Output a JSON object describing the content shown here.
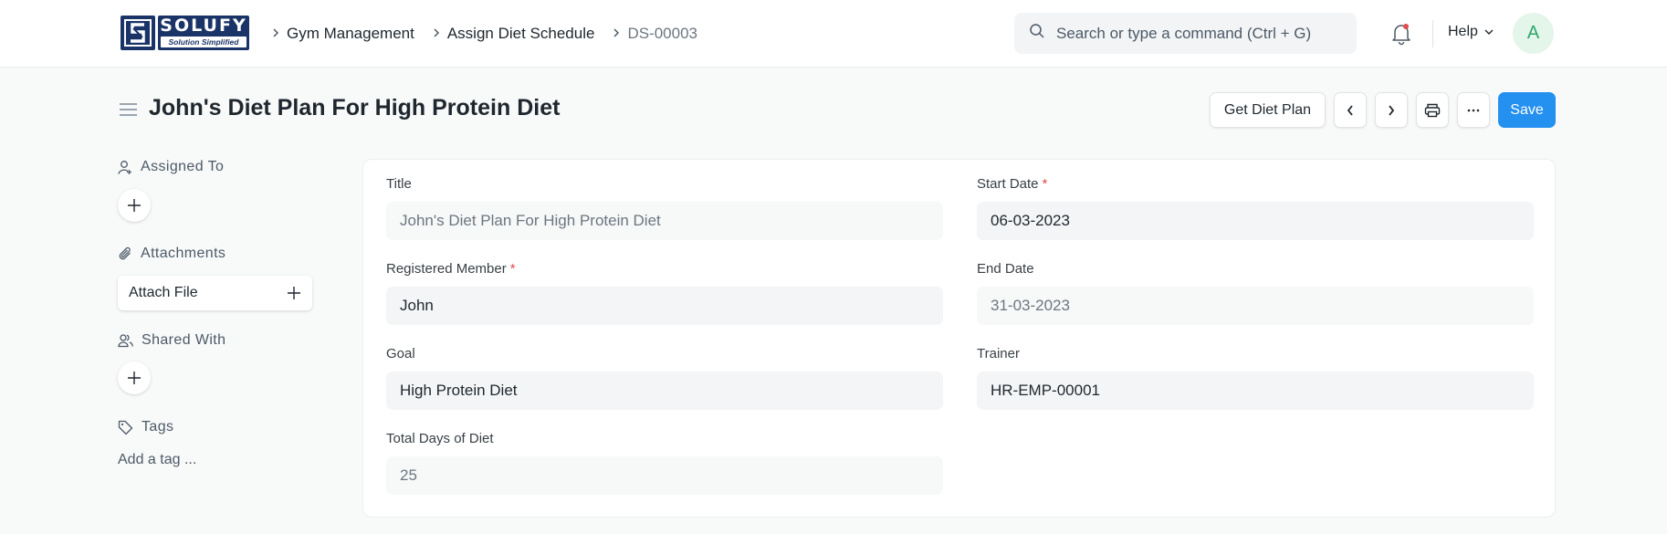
{
  "navbar": {
    "logo": {
      "word": "SOLUFY",
      "tagline": "Solution Simplified"
    },
    "breadcrumbs": [
      "Gym Management",
      "Assign Diet Schedule",
      "DS-00003"
    ],
    "search": {
      "placeholder": "Search or type a command (Ctrl + G)",
      "value": ""
    },
    "notifications_icon": "bell-icon",
    "notification_dot_color": "#e24c4c",
    "help_label": "Help",
    "avatar_initial": "A"
  },
  "page": {
    "title": "John's Diet Plan For High Protein Diet",
    "actions": {
      "get_diet_plan": "Get Diet Plan",
      "prev_icon": "chevron-left-icon",
      "next_icon": "chevron-right-icon",
      "print_icon": "printer-icon",
      "more_icon": "more-horizontal-icon",
      "save": "Save"
    },
    "accent_color": "#2490ef"
  },
  "sidebar": {
    "assigned_to": "Assigned To",
    "attachments": "Attachments",
    "attach_file": "Attach File",
    "shared_with": "Shared With",
    "tags": "Tags",
    "add_tag": "Add a tag ..."
  },
  "form": {
    "left": [
      {
        "label": "Title",
        "value": "John's Diet Plan For High Protein Diet",
        "required": false,
        "readonly": true
      },
      {
        "label": "Registered Member",
        "value": "John",
        "required": true,
        "readonly": false
      },
      {
        "label": "Goal",
        "value": "High Protein Diet",
        "required": false,
        "readonly": false
      },
      {
        "label": "Total Days of Diet",
        "value": "25",
        "required": false,
        "readonly": true
      }
    ],
    "right": [
      {
        "label": "Start Date",
        "value": "06-03-2023",
        "required": true,
        "readonly": false
      },
      {
        "label": "End Date",
        "value": "31-03-2023",
        "required": false,
        "readonly": true
      },
      {
        "label": "Trainer",
        "value": "HR-EMP-00001",
        "required": false,
        "readonly": false
      }
    ],
    "required_mark": "*"
  }
}
